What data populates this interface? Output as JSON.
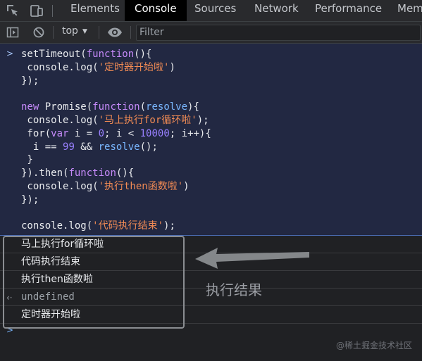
{
  "devtools": {
    "tabs": [
      "Elements",
      "Console",
      "Sources",
      "Network",
      "Performance",
      "Memo"
    ],
    "active_tab": "Console"
  },
  "toolbar": {
    "context": "top",
    "filter_placeholder": "Filter"
  },
  "code_lines": [
    "setTimeout(function(){",
    " console.log('定时器开始啦')",
    "});",
    "",
    "new Promise(function(resolve){",
    " console.log('马上执行for循环啦');",
    " for(var i = 0; i < 10000; i++){",
    "  i == 99 && resolve();",
    " }",
    "}).then(function(){",
    " console.log('执行then函数啦')",
    "});",
    "",
    "console.log('代码执行结束');"
  ],
  "output": [
    {
      "text": "马上执行for循环啦",
      "type": "log"
    },
    {
      "text": "代码执行结束",
      "type": "log"
    },
    {
      "text": "执行then函数啦",
      "type": "log"
    },
    {
      "text": "undefined",
      "type": "return"
    },
    {
      "text": "定时器开始啦",
      "type": "log"
    }
  ],
  "annotation": "执行结果",
  "watermark": "@稀土掘金技术社区",
  "colors": {
    "keyword": "#c58af9",
    "string": "#f28b54",
    "number": "#9980ff",
    "param": "#7ab7ff",
    "background": "#202124",
    "input_background": "#222842"
  },
  "icons": {
    "tabbar": [
      "inspect-element-icon",
      "device-toolbar-icon"
    ],
    "toolbar": [
      "sidebar-toggle-icon",
      "clear-console-icon",
      "live-expression-eye-icon"
    ]
  }
}
